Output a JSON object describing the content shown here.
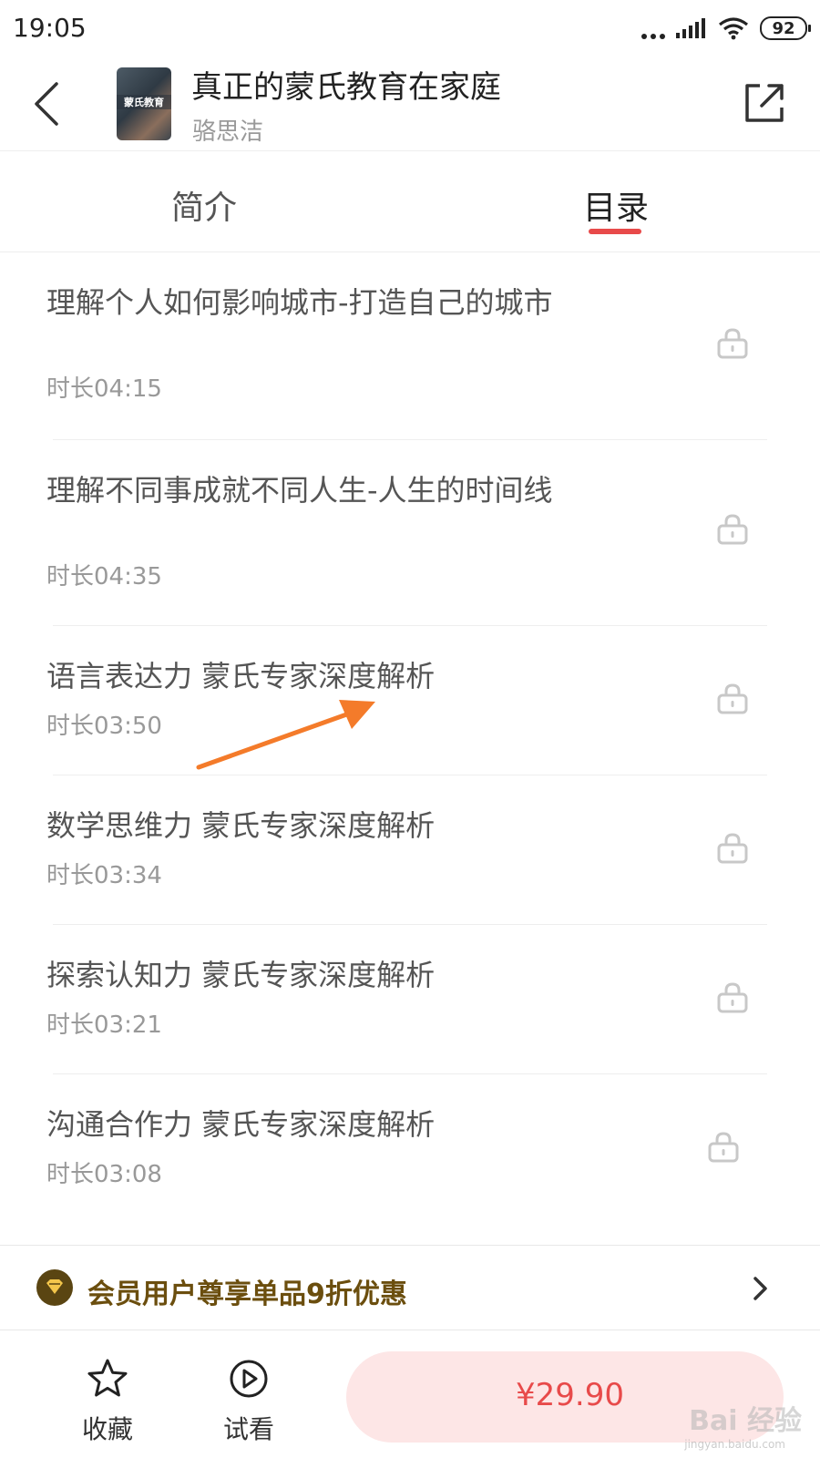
{
  "status_bar": {
    "time": "19:05",
    "battery": "92"
  },
  "header": {
    "cover_text": "蒙氏教育",
    "title": "真正的蒙氏教育在家庭",
    "author": "骆思洁",
    "back_icon": "chevron-left-icon",
    "share_icon": "share-icon"
  },
  "tabs": {
    "intro": "简介",
    "catalog": "目录",
    "active": "catalog"
  },
  "chapters": [
    {
      "title": "理解个人如何影响城市-打造自己的城市",
      "duration": "时长04:15",
      "locked": true
    },
    {
      "title": "理解不同事成就不同人生-人生的时间线",
      "duration": "时长04:35",
      "locked": true
    },
    {
      "title": "语言表达力 蒙氏专家深度解析",
      "duration": "时长03:50",
      "locked": true
    },
    {
      "title": "数学思维力 蒙氏专家深度解析",
      "duration": "时长03:34",
      "locked": true
    },
    {
      "title": "探索认知力 蒙氏专家深度解析",
      "duration": "时长03:21",
      "locked": true
    },
    {
      "title": "沟通合作力 蒙氏专家深度解析",
      "duration": "时长03:08",
      "locked": true
    }
  ],
  "promo": {
    "text": "会员用户尊享单品9折优惠",
    "icon": "vip-diamond-icon"
  },
  "bottom_bar": {
    "favorite_label": "收藏",
    "trial_label": "试看",
    "price": "¥29.90"
  },
  "watermark": {
    "brand": "Bai 经验",
    "url": "jingyan.baidu.com"
  },
  "colors": {
    "accent": "#e84a4a",
    "buy_bg": "#fde6e6",
    "promo_text": "#6b4e0e",
    "annotation_arrow": "#f47b2a"
  }
}
